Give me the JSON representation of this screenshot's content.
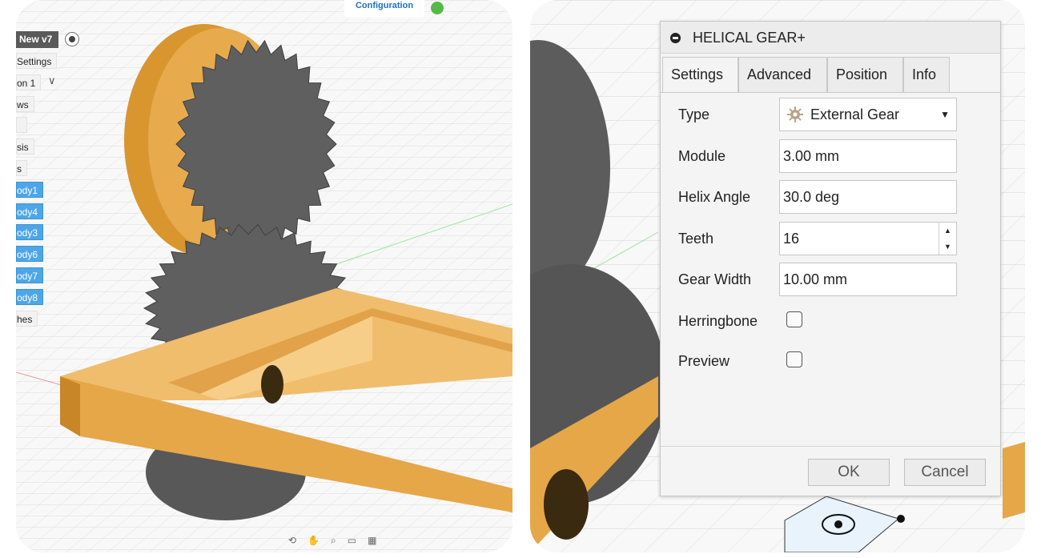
{
  "left": {
    "browser": {
      "component": "New v7",
      "items": [
        {
          "label": "Settings",
          "selected": false
        },
        {
          "label": "on 1",
          "selected": false
        },
        {
          "label": "ws",
          "selected": false
        },
        {
          "label": "",
          "selected": false
        },
        {
          "label": "sis",
          "selected": false
        },
        {
          "label": "s",
          "selected": false
        },
        {
          "label": "ody1",
          "selected": true
        },
        {
          "label": "ody4",
          "selected": true
        },
        {
          "label": "ody3",
          "selected": true
        },
        {
          "label": "ody6",
          "selected": true
        },
        {
          "label": "ody7",
          "selected": true
        },
        {
          "label": "ody8",
          "selected": true
        },
        {
          "label": "hes",
          "selected": false
        }
      ]
    },
    "config_label": "Configuration"
  },
  "dialog": {
    "title": "HELICAL GEAR+",
    "tabs": [
      "Settings",
      "Advanced",
      "Position",
      "Info"
    ],
    "active_tab": "Settings",
    "fields": {
      "type": {
        "label": "Type",
        "value": "External Gear"
      },
      "module": {
        "label": "Module",
        "value": "3.00 mm"
      },
      "helix_angle": {
        "label": "Helix Angle",
        "value": "30.0 deg"
      },
      "teeth": {
        "label": "Teeth",
        "value": "16"
      },
      "gear_width": {
        "label": "Gear Width",
        "value": "10.00 mm"
      },
      "herringbone": {
        "label": "Herringbone",
        "checked": false
      },
      "preview": {
        "label": "Preview",
        "checked": false
      }
    },
    "ok_label": "OK",
    "cancel_label": "Cancel"
  },
  "colors": {
    "wood": "#e3a545",
    "gear": "#5f5f5f",
    "selection": "#4da6e8"
  }
}
